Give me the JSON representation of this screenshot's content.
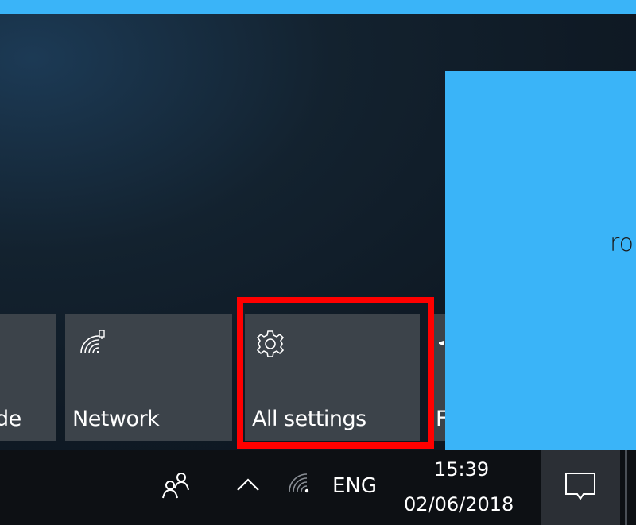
{
  "colors": {
    "overlay_blue": "#3ab4f8",
    "tile_bg": "#3c434a",
    "highlight_red": "#ff0000",
    "taskbar_bg": "#0d1014"
  },
  "quick_actions": {
    "partial_tile_label": "de",
    "network_label": "Network",
    "network_icon": "wifi-network-icon",
    "settings_label": "All settings",
    "settings_icon": "gear-icon",
    "next_tile_label": "F"
  },
  "overlay_panel": {
    "text": "ro"
  },
  "taskbar": {
    "people_icon": "people-icon",
    "tray_chevron_icon": "chevron-up-icon",
    "network_icon": "wifi-icon",
    "language": "ENG",
    "time": "15:39",
    "date": "02/06/2018",
    "action_center_icon": "action-center-icon"
  }
}
